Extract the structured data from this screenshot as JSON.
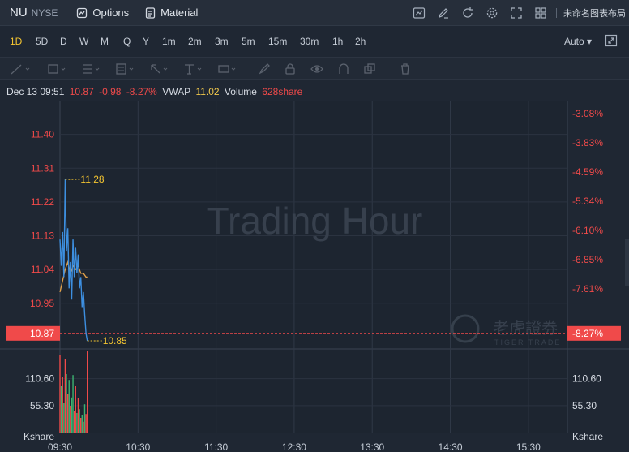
{
  "header": {
    "symbol": "NU",
    "exchange": "NYSE",
    "options_label": "Options",
    "material_label": "Material",
    "layout_label": "未命名图表布局"
  },
  "periods": [
    {
      "label": "1D",
      "active": true
    },
    {
      "label": "5D"
    },
    {
      "label": "D"
    },
    {
      "label": "W"
    },
    {
      "label": "M"
    },
    {
      "label": "Q"
    },
    {
      "label": "Y"
    },
    {
      "label": "1m"
    },
    {
      "label": "2m"
    },
    {
      "label": "3m"
    },
    {
      "label": "5m"
    },
    {
      "label": "15m"
    },
    {
      "label": "30m"
    },
    {
      "label": "1h"
    },
    {
      "label": "2h"
    }
  ],
  "auto_label": "Auto",
  "info": {
    "datetime": "Dec 13 09:51",
    "price": "10.87",
    "change": "-0.98",
    "change_pct": "-8.27%",
    "vwap_label": "VWAP",
    "vwap": "11.02",
    "volume_label": "Volume",
    "volume": "628share"
  },
  "watermark": "Trading Hour",
  "logo_text": "老虎證券",
  "logo_sub": "TIGER TRADE",
  "colors": {
    "up": "#f04a4a",
    "down": "#3cb371",
    "price_line": "#3d8fe0",
    "vwap_line": "#e3a24a",
    "accent": "#f4c531"
  },
  "chart_data": {
    "type": "line",
    "price_axis": [
      "11.40",
      "11.31",
      "11.22",
      "11.13",
      "11.04",
      "10.95"
    ],
    "price_axis_values": [
      11.4,
      11.31,
      11.22,
      11.13,
      11.04,
      10.95
    ],
    "pct_axis": [
      "-3.08%",
      "-3.83%",
      "-4.59%",
      "-5.34%",
      "-6.10%",
      "-6.85%",
      "-7.61%"
    ],
    "ylim": [
      10.835,
      11.49
    ],
    "current_price": "10.87",
    "current_price_value": 10.87,
    "current_pct": "-8.27%",
    "high_label": "11.28",
    "high_value": 11.28,
    "low_label": "10.85",
    "low_value": 10.85,
    "x_labels": [
      "09:30",
      "10:30",
      "11:30",
      "12:30",
      "13:30",
      "14:30",
      "15:30"
    ],
    "x_minutes": [
      0,
      60,
      120,
      180,
      240,
      300,
      360
    ],
    "xlim": [
      0,
      390
    ],
    "price_series": [
      {
        "t": 0,
        "v": 11.12
      },
      {
        "t": 1,
        "v": 11.05
      },
      {
        "t": 2,
        "v": 11.14
      },
      {
        "t": 3,
        "v": 11.02
      },
      {
        "t": 4,
        "v": 11.28
      },
      {
        "t": 5,
        "v": 11.09
      },
      {
        "t": 6,
        "v": 11.15
      },
      {
        "t": 7,
        "v": 10.99
      },
      {
        "t": 8,
        "v": 11.06
      },
      {
        "t": 9,
        "v": 10.96
      },
      {
        "t": 10,
        "v": 11.12
      },
      {
        "t": 11,
        "v": 11.02
      },
      {
        "t": 12,
        "v": 11.1
      },
      {
        "t": 13,
        "v": 11.03
      },
      {
        "t": 14,
        "v": 11.08
      },
      {
        "t": 15,
        "v": 10.99
      },
      {
        "t": 16,
        "v": 11.02
      },
      {
        "t": 17,
        "v": 10.94
      },
      {
        "t": 18,
        "v": 10.98
      },
      {
        "t": 19,
        "v": 10.92
      },
      {
        "t": 20,
        "v": 10.87
      },
      {
        "t": 21,
        "v": 10.85
      }
    ],
    "vwap_series": [
      {
        "t": 0,
        "v": 10.98
      },
      {
        "t": 2,
        "v": 11.01
      },
      {
        "t": 4,
        "v": 11.04
      },
      {
        "t": 6,
        "v": 11.06
      },
      {
        "t": 8,
        "v": 11.03
      },
      {
        "t": 10,
        "v": 11.05
      },
      {
        "t": 12,
        "v": 11.04
      },
      {
        "t": 14,
        "v": 11.05
      },
      {
        "t": 16,
        "v": 11.03
      },
      {
        "t": 18,
        "v": 11.03
      },
      {
        "t": 20,
        "v": 11.02
      },
      {
        "t": 21,
        "v": 11.02
      }
    ],
    "volume_axis": [
      "110.60",
      "55.30"
    ],
    "volume_axis_values": [
      110.6,
      55.3
    ],
    "volume_unit": "Kshare",
    "volume_ylim": [
      0,
      165
    ],
    "volume_bars": [
      {
        "t": 0,
        "v": 160,
        "c": "up"
      },
      {
        "t": 1,
        "v": 95,
        "c": "down"
      },
      {
        "t": 2,
        "v": 115,
        "c": "up"
      },
      {
        "t": 3,
        "v": 60,
        "c": "down"
      },
      {
        "t": 4,
        "v": 150,
        "c": "up"
      },
      {
        "t": 5,
        "v": 120,
        "c": "down"
      },
      {
        "t": 6,
        "v": 80,
        "c": "up"
      },
      {
        "t": 7,
        "v": 108,
        "c": "down"
      },
      {
        "t": 8,
        "v": 55,
        "c": "up"
      },
      {
        "t": 9,
        "v": 72,
        "c": "down"
      },
      {
        "t": 10,
        "v": 118,
        "c": "down"
      },
      {
        "t": 11,
        "v": 45,
        "c": "up"
      },
      {
        "t": 12,
        "v": 95,
        "c": "up"
      },
      {
        "t": 13,
        "v": 40,
        "c": "down"
      },
      {
        "t": 14,
        "v": 70,
        "c": "up"
      },
      {
        "t": 15,
        "v": 48,
        "c": "down"
      },
      {
        "t": 16,
        "v": 30,
        "c": "up"
      },
      {
        "t": 17,
        "v": 35,
        "c": "down"
      },
      {
        "t": 18,
        "v": 22,
        "c": "up"
      },
      {
        "t": 19,
        "v": 58,
        "c": "down"
      },
      {
        "t": 20,
        "v": 38,
        "c": "up"
      },
      {
        "t": 21,
        "v": 168,
        "c": "up"
      }
    ]
  }
}
